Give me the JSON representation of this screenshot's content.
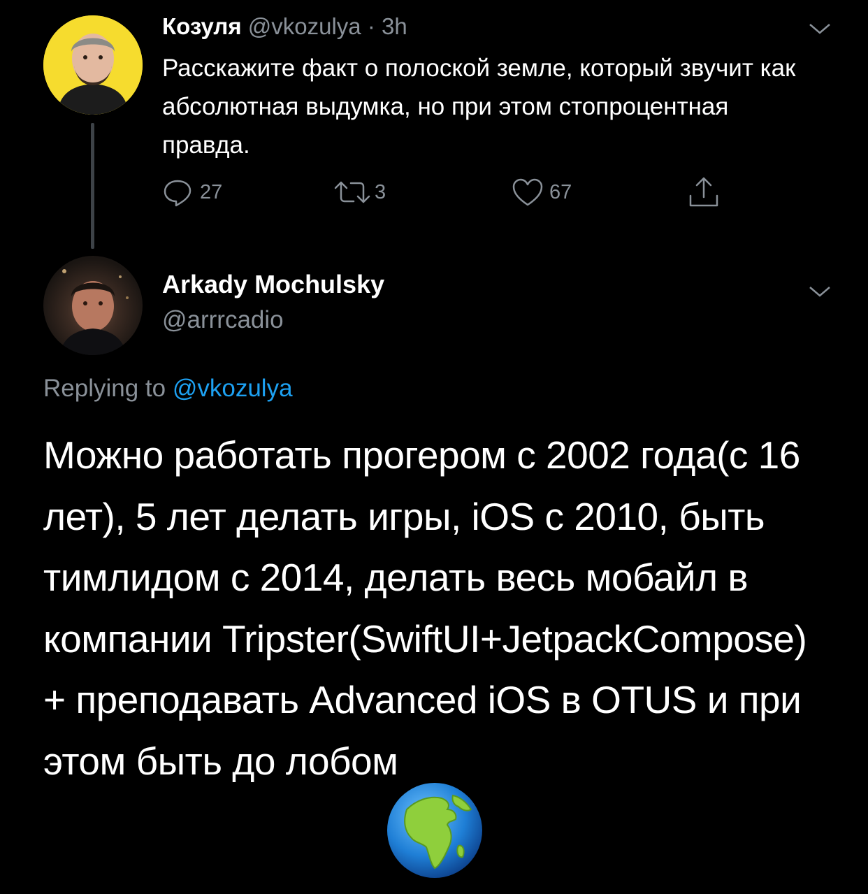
{
  "tweet1": {
    "author_name": "Козуля",
    "handle": "@vkozulya",
    "time": "· 3h",
    "text": "Расскажите факт о полоской земле, который звучит как абсолютная выдумка, но при этом стопроцентная правда.",
    "reply_count": "27",
    "retweet_count": "3",
    "like_count": "67"
  },
  "tweet2": {
    "author_name": "Arkady Mochulsky",
    "handle": "@arrrcadio",
    "replying_prefix": "Replying to",
    "replying_mention": "@vkozulya",
    "text": "Можно работать прогером с 2002 года(с 16 лет), 5 лет делать игры, iOS с 2010, быть тимлидом с 2014, делать весь мобайл в компании Tripster(SwiftUI+JetpackCompose) + преподавать Advanced iOS в OTUS и при этом быть до лобом"
  },
  "icons": {
    "reply": "reply-icon",
    "retweet": "retweet-icon",
    "like": "heart-icon",
    "share": "share-icon",
    "menu": "chevron-down-icon",
    "overlay": "globe-emoji-icon"
  },
  "colors": {
    "background": "#000000",
    "text": "#ffffff",
    "secondary": "#8a9199",
    "link": "#1da1f2",
    "avatar_bg": "#f6dc2e"
  }
}
